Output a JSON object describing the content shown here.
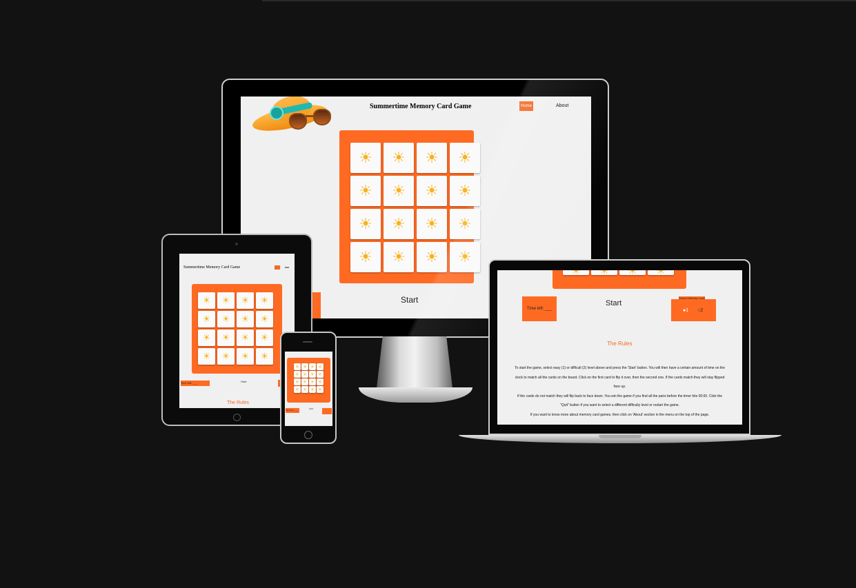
{
  "monitor": {
    "title": "Summertime Memory Card Game",
    "nav_home": "Home",
    "nav_about": "About",
    "start_label": "Start",
    "card_icon": "sun-icon"
  },
  "tablet": {
    "title": "Summertime Memory Card Game",
    "time_left": "Time left: ___",
    "start_label": "Start",
    "rules_heading": "The Rules"
  },
  "phone": {
    "time_left": "Time left: ___",
    "start_label": "Start"
  },
  "laptop": {
    "time_left": "Time left: ___",
    "start_label": "Start",
    "difficulty_label": "Select Difficulty Level",
    "level_1": "1",
    "level_2": "2",
    "rules_heading": "The Rules",
    "rules_lines": [
      "To start the game, select easy (1) or difficult (2) level above and press the 'Start' button. You will then have a certain amount of time on the",
      "clock to match all the cards on the board. Click on the first card to flip it over, then the second one. If the cards match they will stay flipped",
      "face up.",
      "If the cards do not match they will flip back to face down. You win the game if you find all the pairs before the timer hits 00:00. Click the",
      "\"Quit\" button if you want to select a different difficulty level or restart the game.",
      "If you want to know more about memory card games, then click on 'About' section in the menu on the top of the page."
    ]
  },
  "colors": {
    "background": "#131212",
    "accent": "#ff6a23",
    "card_face": "#fafafa",
    "sun": "#f7b21b",
    "screen": "#f0f0f0"
  }
}
